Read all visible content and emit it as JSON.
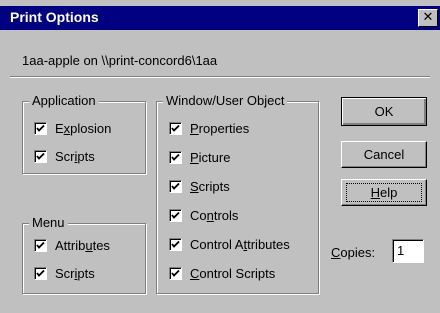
{
  "window": {
    "title": "Print Options",
    "close_glyph": "✕"
  },
  "printer": {
    "text": "1aa-apple on \\\\print-concord6\\1aa"
  },
  "application": {
    "legend": "Application",
    "items": [
      {
        "label": "Explosion",
        "mnemonic_index": 1,
        "checked": true
      },
      {
        "label": "Scripts",
        "mnemonic_index": 3,
        "checked": true
      }
    ]
  },
  "menu": {
    "legend": "Menu",
    "items": [
      {
        "label": "Attributes",
        "mnemonic_index": 6,
        "checked": true
      },
      {
        "label": "Scripts",
        "mnemonic_index": 3,
        "checked": true
      }
    ]
  },
  "window_user_object": {
    "legend": "Window/User Object",
    "items": [
      {
        "label": "Properties",
        "mnemonic_index": 0,
        "checked": true
      },
      {
        "label": "Picture",
        "mnemonic_index": 0,
        "checked": true
      },
      {
        "label": "Scripts",
        "mnemonic_index": 0,
        "checked": true
      },
      {
        "label": "Controls",
        "mnemonic_index": 2,
        "checked": true
      },
      {
        "label": "Control Attributes",
        "mnemonic_index": 9,
        "checked": true
      },
      {
        "label": "Control Scripts",
        "mnemonic_index": 0,
        "checked": true
      }
    ]
  },
  "buttons": {
    "ok": "OK",
    "cancel": "Cancel",
    "help": "Help"
  },
  "copies": {
    "label": "Copies:",
    "value": "1"
  },
  "colors": {
    "titlebar": "#000080",
    "face": "#c0c0c0"
  }
}
